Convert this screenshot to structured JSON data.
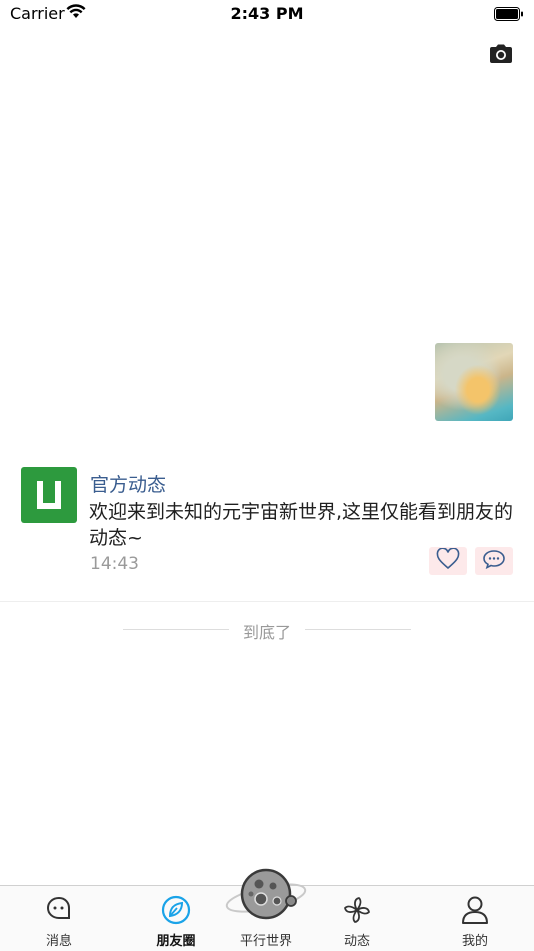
{
  "status": {
    "carrier": "Carrier",
    "time": "2:43 PM"
  },
  "post": {
    "author": "官方动态",
    "text": "欢迎来到未知的元宇宙新世界,这里仅能看到朋友的动态~",
    "time": "14:43"
  },
  "feed": {
    "end_text": "到底了"
  },
  "tabs": [
    {
      "label": "消息",
      "icon": "chat-bubble-icon"
    },
    {
      "label": "朋友圈",
      "icon": "compass-leaf-icon",
      "active": true
    },
    {
      "label": "平行世界",
      "icon": "planet-icon"
    },
    {
      "label": "动态",
      "icon": "pinwheel-icon"
    },
    {
      "label": "我的",
      "icon": "person-icon"
    }
  ],
  "colors": {
    "accent": "#1aa3e8",
    "author": "#3a5d8f",
    "brand_green": "#2d9a3e",
    "action_bg": "#fde9ea"
  }
}
